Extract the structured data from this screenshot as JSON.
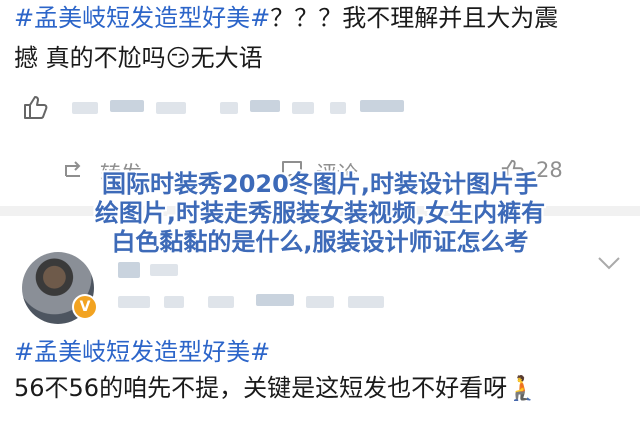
{
  "post": {
    "tag": "#孟美岐短发造型好美#",
    "line1_rest": "？？？我不理解并且大为震",
    "line2_pre": "撼 真的不尬吗",
    "emoji": "😏",
    "line2_post": "无大语"
  },
  "actions": {
    "repost_label": "转发",
    "comment_label": "评论",
    "like_count": "28"
  },
  "overlay": {
    "line1": "国际时装秀2020冬图片,时装设计图片手",
    "line2": "绘图片,时装走秀服装女装视频,女生内裤有",
    "line3": "白色黏黏的是什么,服装设计师证怎么考"
  },
  "post2": {
    "verified_badge": "V",
    "tag": "#孟美岐短发造型好美#",
    "body": "56不56的咱先不提，关键是这短发也不好看呀",
    "emoji": "🧎"
  },
  "icons": [
    "like-icon",
    "repost-icon",
    "comment-icon",
    "chevron-down-icon"
  ]
}
